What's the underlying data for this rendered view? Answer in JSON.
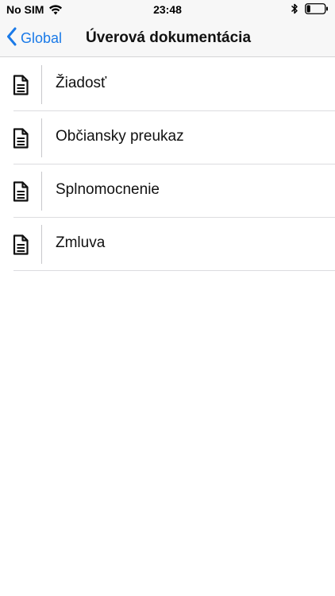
{
  "status_bar": {
    "carrier": "No SIM",
    "time": "23:48",
    "wifi_icon": "wifi-icon",
    "bluetooth_icon": "bluetooth-icon",
    "battery_icon": "battery-icon",
    "battery_level": 0.2
  },
  "nav": {
    "back_label": "Global",
    "back_icon": "chevron-left-icon",
    "title": "Úverová dokumentácia",
    "accent_color": "#1a7ae8"
  },
  "documents": [
    {
      "label": "Žiadosť",
      "icon": "document-icon"
    },
    {
      "label": "Občiansky preukaz",
      "icon": "document-icon"
    },
    {
      "label": "Splnomocnenie",
      "icon": "document-icon"
    },
    {
      "label": "Zmluva",
      "icon": "document-icon"
    }
  ]
}
